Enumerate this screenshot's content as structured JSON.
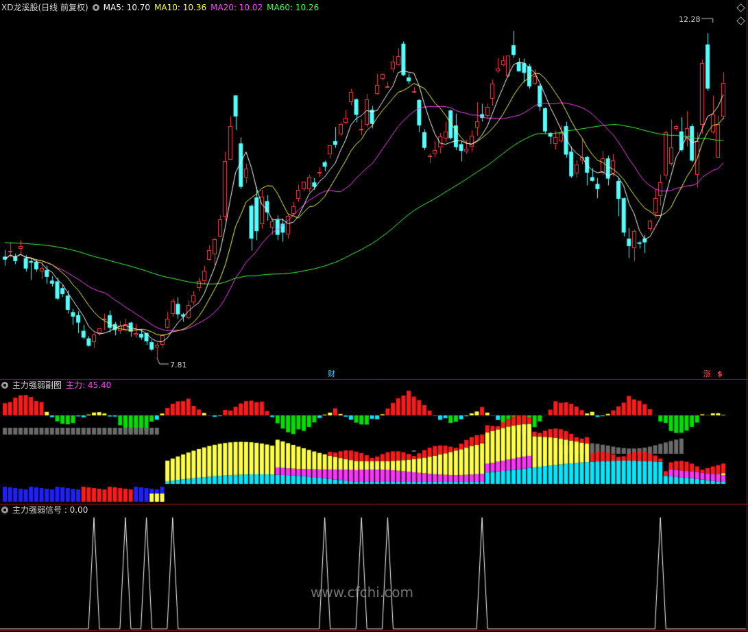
{
  "main_panel": {
    "stock_title": "XD龙溪股(日线 前复权)",
    "indicators": [
      {
        "label": "MA5: 10.70",
        "color": "#ffffff"
      },
      {
        "label": "MA10: 10.36",
        "color": "#ffff44"
      },
      {
        "label": "MA20: 10.02",
        "color": "#ff44ff"
      },
      {
        "label": "MA60: 10.26",
        "color": "#44ff44"
      }
    ],
    "high_label": "12.28",
    "low_label": "7.81",
    "fin_tag": "财",
    "limit_tag": "涨",
    "limit_icon_label": "$"
  },
  "sub_panel_1": {
    "title": "主力强弱副图",
    "value_label": "主力: 45.40",
    "value_color": "#ff44ff"
  },
  "sub_panel_2": {
    "title": "主力强弱信号 : 0.00"
  },
  "watermark": "www.cfchi.com",
  "colors": {
    "up": "#ff3c3c",
    "down": "#54ffff",
    "ma5": "#ffffff",
    "ma10": "#ffff44",
    "ma20": "#ff44ff",
    "ma60": "#44ff44",
    "separator": "#b01818",
    "bar_red": "#ff1a1a",
    "bar_yellow": "#ffff44",
    "bar_cyan": "#00e8ff",
    "bar_green": "#00e000",
    "bar_gray": "#6a6a6a",
    "bar_magenta": "#ff33ff",
    "bar_blue": "#2020ff"
  },
  "chart_data": {
    "type": "candlestick",
    "price_range": [
      7.6,
      12.4
    ],
    "candles": [
      [
        9.16,
        9.12,
        9.25,
        9.04
      ],
      [
        9.22,
        9.24,
        9.35,
        9.15
      ],
      [
        9.16,
        9.1,
        9.2,
        9.06
      ],
      [
        9.26,
        9.3,
        9.38,
        9.2
      ],
      [
        9.14,
        9.0,
        9.18,
        8.96
      ],
      [
        9.1,
        9.08,
        9.14,
        8.85
      ],
      [
        9.09,
        8.99,
        9.12,
        8.96
      ],
      [
        8.96,
        9.01,
        9.08,
        8.86
      ],
      [
        8.98,
        8.89,
        9.04,
        8.8
      ],
      [
        8.84,
        8.8,
        8.9,
        8.76
      ],
      [
        8.83,
        8.6,
        8.88,
        8.58
      ],
      [
        8.74,
        8.66,
        8.78,
        8.62
      ],
      [
        8.64,
        8.45,
        8.71,
        8.4
      ],
      [
        8.42,
        8.36,
        8.46,
        8.25
      ],
      [
        8.38,
        8.28,
        8.43,
        8.14
      ],
      [
        8.17,
        8.08,
        8.25,
        8.06
      ],
      [
        8.07,
        7.97,
        8.1,
        7.96
      ],
      [
        8.02,
        8.12,
        8.14,
        7.94
      ],
      [
        8.14,
        8.2,
        8.2,
        8.11
      ],
      [
        8.33,
        8.33,
        8.4,
        8.18
      ],
      [
        8.38,
        8.21,
        8.44,
        8.15
      ],
      [
        8.26,
        8.18,
        8.29,
        8.11
      ],
      [
        8.17,
        8.24,
        8.3,
        8.13
      ],
      [
        8.18,
        8.26,
        8.33,
        8.17
      ],
      [
        8.28,
        8.16,
        8.29,
        8.09
      ],
      [
        8.11,
        8.14,
        8.26,
        8.08
      ],
      [
        8.13,
        8.08,
        8.19,
        8.05
      ],
      [
        8.14,
        8.03,
        8.15,
        7.98
      ],
      [
        8.02,
        7.92,
        8.05,
        7.9
      ],
      [
        7.94,
        7.98,
        8.01,
        7.81
      ],
      [
        7.98,
        8.11,
        8.13,
        7.94
      ],
      [
        8.21,
        8.33,
        8.42,
        8.2
      ],
      [
        8.4,
        8.57,
        8.6,
        8.36
      ],
      [
        8.53,
        8.39,
        8.62,
        8.33
      ],
      [
        8.39,
        8.36,
        8.41,
        8.29
      ],
      [
        8.34,
        8.51,
        8.58,
        8.32
      ],
      [
        8.55,
        8.64,
        8.7,
        8.52
      ],
      [
        8.74,
        8.83,
        8.88,
        8.7
      ],
      [
        8.83,
        8.97,
        9.04,
        8.79
      ],
      [
        9.12,
        9.25,
        9.31,
        9.11
      ],
      [
        9.19,
        9.39,
        9.41,
        9.05
      ],
      [
        9.43,
        9.66,
        9.71,
        9.42
      ],
      [
        9.69,
        10.43,
        10.56,
        9.64
      ],
      [
        10.45,
        10.9,
        11.03,
        10.45
      ],
      [
        11.31,
        11.03,
        11.31,
        10.85
      ],
      [
        10.67,
        10.09,
        10.75,
        10.06
      ],
      [
        10.21,
        10.33,
        10.4,
        10.14
      ],
      [
        9.84,
        9.4,
        9.86,
        9.24
      ],
      [
        9.95,
        9.5,
        10.09,
        9.38
      ],
      [
        9.59,
        9.96,
        10.05,
        9.53
      ],
      [
        9.9,
        9.75,
        9.98,
        9.64
      ],
      [
        9.55,
        9.63,
        9.67,
        9.45
      ],
      [
        9.65,
        9.45,
        9.71,
        9.38
      ],
      [
        9.6,
        9.48,
        9.67,
        9.36
      ],
      [
        9.45,
        9.7,
        9.73,
        9.4
      ],
      [
        9.73,
        9.83,
        9.89,
        9.71
      ],
      [
        9.93,
        10.05,
        10.12,
        9.89
      ],
      [
        10.06,
        10.16,
        10.16,
        10.03
      ],
      [
        10.06,
        10.22,
        10.25,
        10.02
      ],
      [
        10.15,
        10.09,
        10.21,
        10.05
      ],
      [
        10.27,
        10.29,
        10.35,
        10.22
      ],
      [
        10.42,
        10.36,
        10.44,
        10.3
      ],
      [
        10.52,
        10.64,
        10.64,
        10.47
      ],
      [
        10.7,
        10.65,
        10.89,
        10.61
      ],
      [
        10.79,
        10.93,
        10.95,
        10.77
      ],
      [
        10.95,
        11.01,
        11.12,
        10.93
      ],
      [
        11.22,
        11.36,
        11.4,
        11.18
      ],
      [
        11.26,
        11.05,
        11.27,
        10.95
      ],
      [
        10.86,
        10.86,
        10.99,
        10.78
      ],
      [
        10.92,
        11.26,
        11.33,
        10.89
      ],
      [
        11.12,
        10.93,
        11.17,
        10.87
      ],
      [
        11.33,
        11.45,
        11.6,
        11.32
      ],
      [
        11.54,
        11.6,
        11.61,
        11.51
      ],
      [
        11.42,
        11.43,
        11.49,
        11.41
      ],
      [
        11.66,
        11.76,
        11.84,
        11.61
      ],
      [
        11.71,
        11.83,
        11.94,
        11.7
      ],
      [
        12.0,
        11.58,
        12.03,
        11.57
      ],
      [
        11.55,
        11.5,
        11.6,
        11.46
      ],
      [
        11.37,
        11.37,
        11.42,
        11.34
      ],
      [
        11.25,
        10.91,
        11.26,
        10.82
      ],
      [
        10.82,
        10.61,
        10.86,
        10.58
      ],
      [
        10.49,
        10.51,
        10.53,
        10.41
      ],
      [
        10.53,
        10.58,
        10.7,
        10.49
      ],
      [
        10.61,
        10.76,
        10.81,
        10.54
      ],
      [
        10.74,
        10.83,
        10.96,
        10.69
      ],
      [
        11.11,
        10.74,
        11.12,
        10.72
      ],
      [
        10.91,
        10.62,
        11.07,
        10.58
      ],
      [
        10.66,
        10.57,
        10.71,
        10.43
      ],
      [
        10.56,
        10.6,
        10.72,
        10.53
      ],
      [
        10.62,
        10.77,
        10.84,
        10.56
      ],
      [
        10.88,
        10.96,
        11.22,
        10.77
      ],
      [
        11.06,
        11.01,
        11.2,
        10.96
      ],
      [
        11.04,
        11.16,
        11.2,
        11.0
      ],
      [
        11.27,
        11.47,
        11.52,
        11.17
      ],
      [
        11.63,
        11.67,
        11.81,
        11.61
      ],
      [
        11.72,
        11.78,
        11.84,
        11.7
      ],
      [
        11.57,
        11.84,
        11.84,
        11.55
      ],
      [
        11.98,
        11.85,
        12.17,
        11.81
      ],
      [
        11.75,
        11.63,
        11.81,
        11.63
      ],
      [
        11.74,
        11.61,
        11.8,
        11.48
      ],
      [
        11.7,
        11.43,
        11.73,
        11.4
      ],
      [
        11.47,
        11.57,
        11.66,
        11.45
      ],
      [
        11.44,
        11.16,
        11.46,
        11.1
      ],
      [
        11.14,
        10.83,
        11.15,
        10.8
      ],
      [
        10.81,
        10.76,
        10.82,
        10.66
      ],
      [
        10.66,
        10.75,
        10.84,
        10.59
      ],
      [
        10.7,
        10.81,
        10.91,
        10.68
      ],
      [
        10.9,
        10.52,
        10.96,
        10.48
      ],
      [
        10.56,
        10.23,
        10.63,
        10.21
      ],
      [
        10.27,
        10.39,
        10.45,
        10.21
      ],
      [
        10.44,
        10.49,
        10.73,
        10.39
      ],
      [
        10.49,
        10.28,
        10.5,
        10.11
      ],
      [
        10.22,
        10.17,
        10.34,
        10.16
      ],
      [
        10.13,
        10.06,
        10.21,
        9.94
      ],
      [
        10.28,
        10.47,
        10.57,
        10.25
      ],
      [
        10.47,
        10.2,
        10.51,
        10.11
      ],
      [
        10.27,
        10.44,
        10.53,
        10.23
      ],
      [
        10.17,
        9.93,
        10.21,
        9.7
      ],
      [
        9.94,
        9.48,
        9.95,
        9.43
      ],
      [
        9.4,
        9.3,
        9.54,
        9.14
      ],
      [
        9.27,
        9.5,
        9.52,
        9.1
      ],
      [
        9.35,
        9.33,
        9.37,
        9.27
      ],
      [
        9.4,
        9.35,
        9.45,
        9.21
      ],
      [
        9.53,
        9.64,
        9.65,
        9.5
      ],
      [
        9.74,
        9.94,
        10.06,
        9.68
      ],
      [
        9.97,
        10.15,
        10.25,
        9.84
      ],
      [
        10.24,
        10.82,
        10.84,
        10.19
      ],
      [
        10.4,
        10.62,
        10.99,
        10.37
      ],
      [
        10.86,
        10.9,
        10.91,
        10.84
      ],
      [
        10.83,
        10.58,
        11.02,
        10.56
      ],
      [
        10.73,
        10.87,
        11.1,
        10.63
      ],
      [
        10.9,
        10.44,
        10.93,
        10.42
      ],
      [
        10.25,
        10.7,
        10.82,
        10.08
      ],
      [
        10.92,
        11.74,
        11.79,
        10.8
      ],
      [
        11.99,
        11.4,
        12.14,
        11.37
      ],
      [
        10.82,
        11.06,
        11.31,
        10.8
      ],
      [
        10.48,
        10.93,
        11.04,
        10.48
      ],
      [
        11.03,
        11.48,
        11.62,
        10.99
      ]
    ]
  }
}
